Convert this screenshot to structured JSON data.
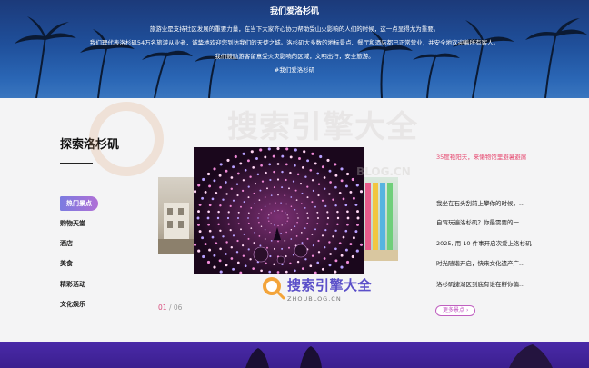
{
  "hero": {
    "title": "我们爱洛杉矶",
    "lines": [
      "旅游业是支持社区发展的重要力量，在当下大家齐心协力帮助受山火影响的人们的时候，这一点显得尤为重要。",
      "我们理代表洛杉矶54万名旅游从业者，诚挚地欢迎您到访我们的天使之城。洛杉矶大多数的地标景点、餐厅和酒店都已正常营业，并安全地欢迎着所有客人。",
      "我们鼓励游客留意受火灾影响的区域，文明出行，安全旅游。",
      "#我们爱洛杉矶"
    ]
  },
  "explore": {
    "title": "探索洛杉矶",
    "categories": [
      "热门景点",
      "购物天堂",
      "酒店",
      "美食",
      "精彩活动",
      "文化娱乐"
    ],
    "pager": {
      "current": "01",
      "separator": "/",
      "total": "06"
    },
    "highlight": "35度艳阳天，来懒物馆里避暑避屑",
    "news": [
      "我坐在石头刮前上攀你的时候，...",
      "自驾玩遍洛杉矶？你最需要的一...",
      "2025, 用 10 件事开启次爱上洛杉矶",
      "时光随谐开启，快来文化遗产广...",
      "洛杉矶捷湖区到底有谁在孵你偏..."
    ],
    "more": "更多景点",
    "more_arrow": "›"
  },
  "watermark": {
    "name": "搜索引擎大全",
    "url": "ZHOUBLOG.CN",
    "big_name": "搜索引擎大全",
    "big_url": "BLOG.CN"
  },
  "colors": {
    "accent_pink": "#e6466e",
    "accent_purple": "#b070d6",
    "hero_blue": "#1f4f9a",
    "band_purple": "#4a2aa8"
  }
}
